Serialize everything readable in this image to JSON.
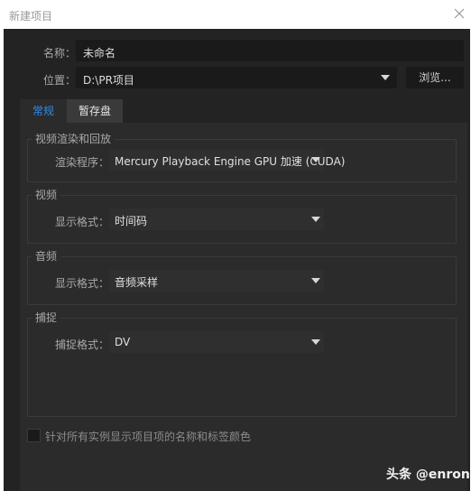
{
  "window": {
    "title": "新建项目",
    "close_icon": "close-icon"
  },
  "project": {
    "name_label": "名称：",
    "name_value": "未命名",
    "location_label": "位置：",
    "location_value": "D:\\PR项目",
    "browse_label": "浏览..."
  },
  "tabs": [
    {
      "label": "常规",
      "active": true
    },
    {
      "label": "暂存盘",
      "active": false
    }
  ],
  "sections": {
    "render": {
      "title": "视频渲染和回放",
      "renderer_label": "渲染程序：",
      "renderer_value": "Mercury Playback Engine GPU 加速 (CUDA)"
    },
    "video": {
      "title": "视频",
      "format_label": "显示格式：",
      "format_value": "时间码"
    },
    "audio": {
      "title": "音频",
      "format_label": "显示格式：",
      "format_value": "音频采样"
    },
    "capture": {
      "title": "捕捉",
      "format_label": "捕捉格式：",
      "format_value": "DV"
    }
  },
  "checkbox": {
    "label": "针对所有实例显示项目项的名称和标签颜色",
    "checked": false
  },
  "watermark": "头条 @enron",
  "colors": {
    "dialog_bg": "#232323",
    "panel_bg": "#2b2b2b",
    "accent": "#2d8ceb"
  }
}
